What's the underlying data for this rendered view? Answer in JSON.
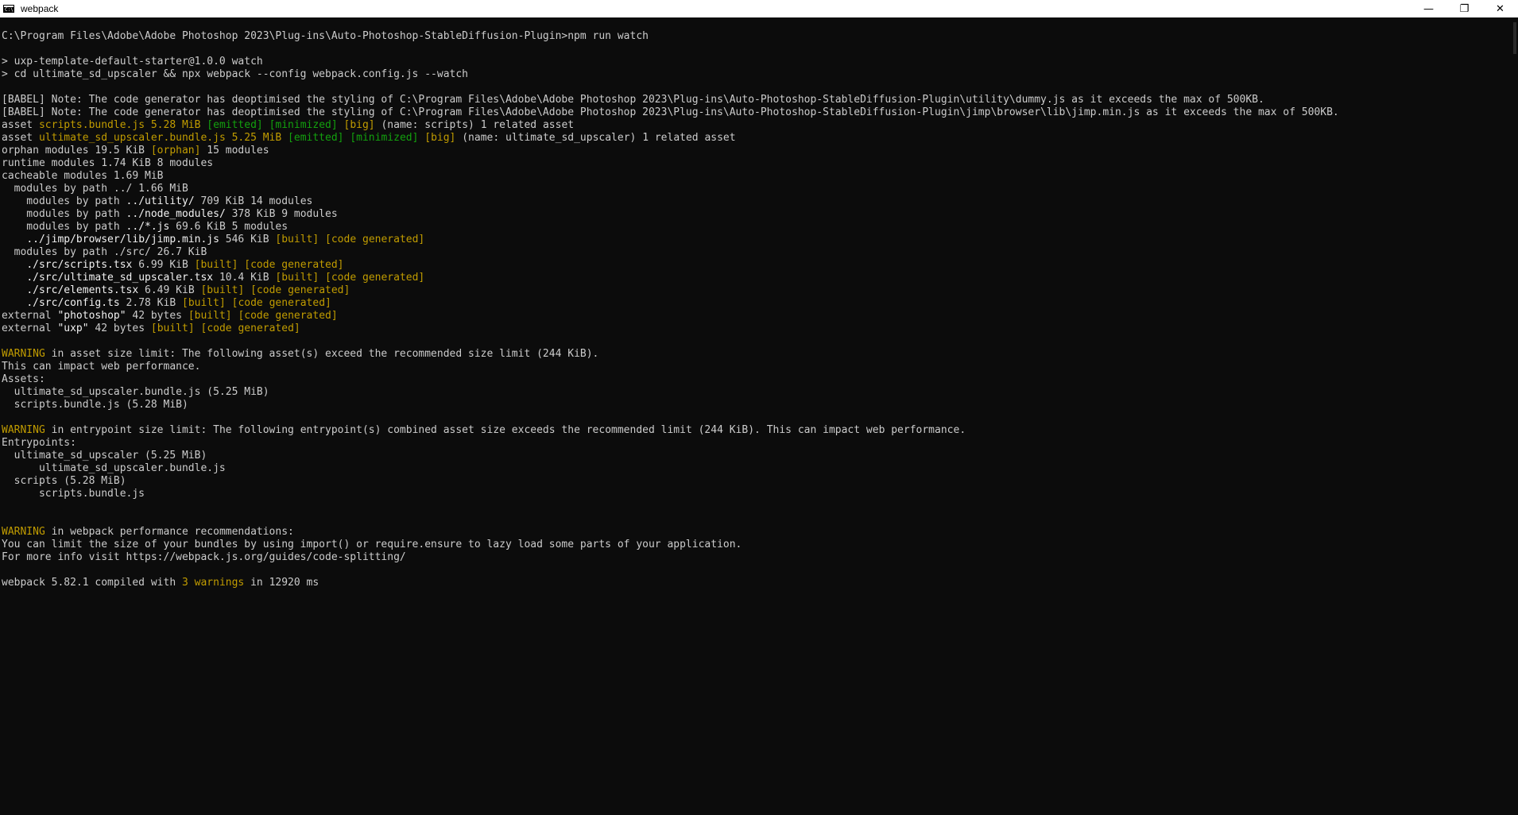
{
  "window": {
    "title": "webpack",
    "icon_label": "C:\\",
    "controls": {
      "minimize": "—",
      "restore": "❐",
      "close": "✕"
    }
  },
  "console": {
    "lines": [
      [
        {
          "t": "C:\\Program Files\\Adobe\\Adobe Photoshop 2023\\Plug-ins\\Auto-Photoshop-StableDiffusion-Plugin>npm run watch"
        }
      ],
      [],
      [
        {
          "t": "> uxp-template-default-starter@1.0.0 watch"
        }
      ],
      [
        {
          "t": "> cd ultimate_sd_upscaler && npx webpack --config webpack.config.js --watch"
        }
      ],
      [],
      [
        {
          "t": "[BABEL] Note: The code generator has deoptimised the styling of C:\\Program Files\\Adobe\\Adobe Photoshop 2023\\Plug-ins\\Auto-Photoshop-StableDiffusion-Plugin\\utility\\dummy.js as it exceeds the max of 500KB."
        }
      ],
      [
        {
          "t": "[BABEL] Note: The code generator has deoptimised the styling of C:\\Program Files\\Adobe\\Adobe Photoshop 2023\\Plug-ins\\Auto-Photoshop-StableDiffusion-Plugin\\jimp\\browser\\lib\\jimp.min.js as it exceeds the max of 500KB."
        }
      ],
      [
        {
          "t": "asset "
        },
        {
          "t": "scripts.bundle.js 5.28 MiB",
          "c": "y"
        },
        {
          "t": " "
        },
        {
          "t": "[emitted]",
          "c": "g"
        },
        {
          "t": " "
        },
        {
          "t": "[minimized]",
          "c": "g"
        },
        {
          "t": " "
        },
        {
          "t": "[big]",
          "c": "y"
        },
        {
          "t": " (name: scripts) 1 related asset"
        }
      ],
      [
        {
          "t": "asset "
        },
        {
          "t": "ultimate_sd_upscaler.bundle.js 5.25 MiB",
          "c": "y"
        },
        {
          "t": " "
        },
        {
          "t": "[emitted]",
          "c": "g"
        },
        {
          "t": " "
        },
        {
          "t": "[minimized]",
          "c": "g"
        },
        {
          "t": " "
        },
        {
          "t": "[big]",
          "c": "y"
        },
        {
          "t": " (name: ultimate_sd_upscaler) 1 related asset"
        }
      ],
      [
        {
          "t": "orphan modules 19.5 KiB "
        },
        {
          "t": "[orphan]",
          "c": "y"
        },
        {
          "t": " 15 modules"
        }
      ],
      [
        {
          "t": "runtime modules 1.74 KiB 8 modules"
        }
      ],
      [
        {
          "t": "cacheable modules 1.69 MiB"
        }
      ],
      [
        {
          "t": "  modules by path ../ 1.66 MiB"
        }
      ],
      [
        {
          "t": "    modules by path "
        },
        {
          "t": "../utility/",
          "c": "b"
        },
        {
          "t": " 709 KiB 14 modules"
        }
      ],
      [
        {
          "t": "    modules by path "
        },
        {
          "t": "../node_modules/",
          "c": "b"
        },
        {
          "t": " 378 KiB 9 modules"
        }
      ],
      [
        {
          "t": "    modules by path "
        },
        {
          "t": "../*.js",
          "c": "b"
        },
        {
          "t": " 69.6 KiB 5 modules"
        }
      ],
      [
        {
          "t": "    "
        },
        {
          "t": "../jimp/browser/lib/jimp.min.js",
          "c": "b"
        },
        {
          "t": " 546 KiB "
        },
        {
          "t": "[built]",
          "c": "y"
        },
        {
          "t": " "
        },
        {
          "t": "[code generated]",
          "c": "y"
        }
      ],
      [
        {
          "t": "  modules by path ./src/ 26.7 KiB"
        }
      ],
      [
        {
          "t": "    "
        },
        {
          "t": "./src/scripts.tsx",
          "c": "b"
        },
        {
          "t": " 6.99 KiB "
        },
        {
          "t": "[built]",
          "c": "y"
        },
        {
          "t": " "
        },
        {
          "t": "[code generated]",
          "c": "y"
        }
      ],
      [
        {
          "t": "    "
        },
        {
          "t": "./src/ultimate_sd_upscaler.tsx",
          "c": "b"
        },
        {
          "t": " 10.4 KiB "
        },
        {
          "t": "[built]",
          "c": "y"
        },
        {
          "t": " "
        },
        {
          "t": "[code generated]",
          "c": "y"
        }
      ],
      [
        {
          "t": "    "
        },
        {
          "t": "./src/elements.tsx",
          "c": "b"
        },
        {
          "t": " 6.49 KiB "
        },
        {
          "t": "[built]",
          "c": "y"
        },
        {
          "t": " "
        },
        {
          "t": "[code generated]",
          "c": "y"
        }
      ],
      [
        {
          "t": "    "
        },
        {
          "t": "./src/config.ts",
          "c": "b"
        },
        {
          "t": " 2.78 KiB "
        },
        {
          "t": "[built]",
          "c": "y"
        },
        {
          "t": " "
        },
        {
          "t": "[code generated]",
          "c": "y"
        }
      ],
      [
        {
          "t": "external "
        },
        {
          "t": "\"photoshop\"",
          "c": "b"
        },
        {
          "t": " 42 bytes "
        },
        {
          "t": "[built]",
          "c": "y"
        },
        {
          "t": " "
        },
        {
          "t": "[code generated]",
          "c": "y"
        }
      ],
      [
        {
          "t": "external "
        },
        {
          "t": "\"uxp\"",
          "c": "b"
        },
        {
          "t": " 42 bytes "
        },
        {
          "t": "[built]",
          "c": "y"
        },
        {
          "t": " "
        },
        {
          "t": "[code generated]",
          "c": "y"
        }
      ],
      [],
      [
        {
          "t": "WARNING",
          "c": "y"
        },
        {
          "t": " in asset size limit: The following asset(s) exceed the recommended size limit (244 KiB)."
        }
      ],
      [
        {
          "t": "This can impact web performance."
        }
      ],
      [
        {
          "t": "Assets:"
        }
      ],
      [
        {
          "t": "  ultimate_sd_upscaler.bundle.js (5.25 MiB)"
        }
      ],
      [
        {
          "t": "  scripts.bundle.js (5.28 MiB)"
        }
      ],
      [],
      [
        {
          "t": "WARNING",
          "c": "y"
        },
        {
          "t": " in entrypoint size limit: The following entrypoint(s) combined asset size exceeds the recommended limit (244 KiB). This can impact web performance."
        }
      ],
      [
        {
          "t": "Entrypoints:"
        }
      ],
      [
        {
          "t": "  ultimate_sd_upscaler (5.25 MiB)"
        }
      ],
      [
        {
          "t": "      ultimate_sd_upscaler.bundle.js"
        }
      ],
      [
        {
          "t": "  scripts (5.28 MiB)"
        }
      ],
      [
        {
          "t": "      scripts.bundle.js"
        }
      ],
      [],
      [],
      [
        {
          "t": "WARNING",
          "c": "y"
        },
        {
          "t": " in webpack performance recommendations:"
        }
      ],
      [
        {
          "t": "You can limit the size of your bundles by using import() or require.ensure to lazy load some parts of your application."
        }
      ],
      [
        {
          "t": "For more info visit https://webpack.js.org/guides/code-splitting/"
        }
      ],
      [],
      [
        {
          "t": "webpack 5.82.1 compiled with "
        },
        {
          "t": "3 warnings",
          "c": "y"
        },
        {
          "t": " in 12920 ms"
        }
      ]
    ]
  },
  "colors": {
    "background": "#0c0c0c",
    "text": "#cccccc",
    "green": "#13a10e",
    "yellow": "#c19c00",
    "bright": "#f2f2f2"
  }
}
